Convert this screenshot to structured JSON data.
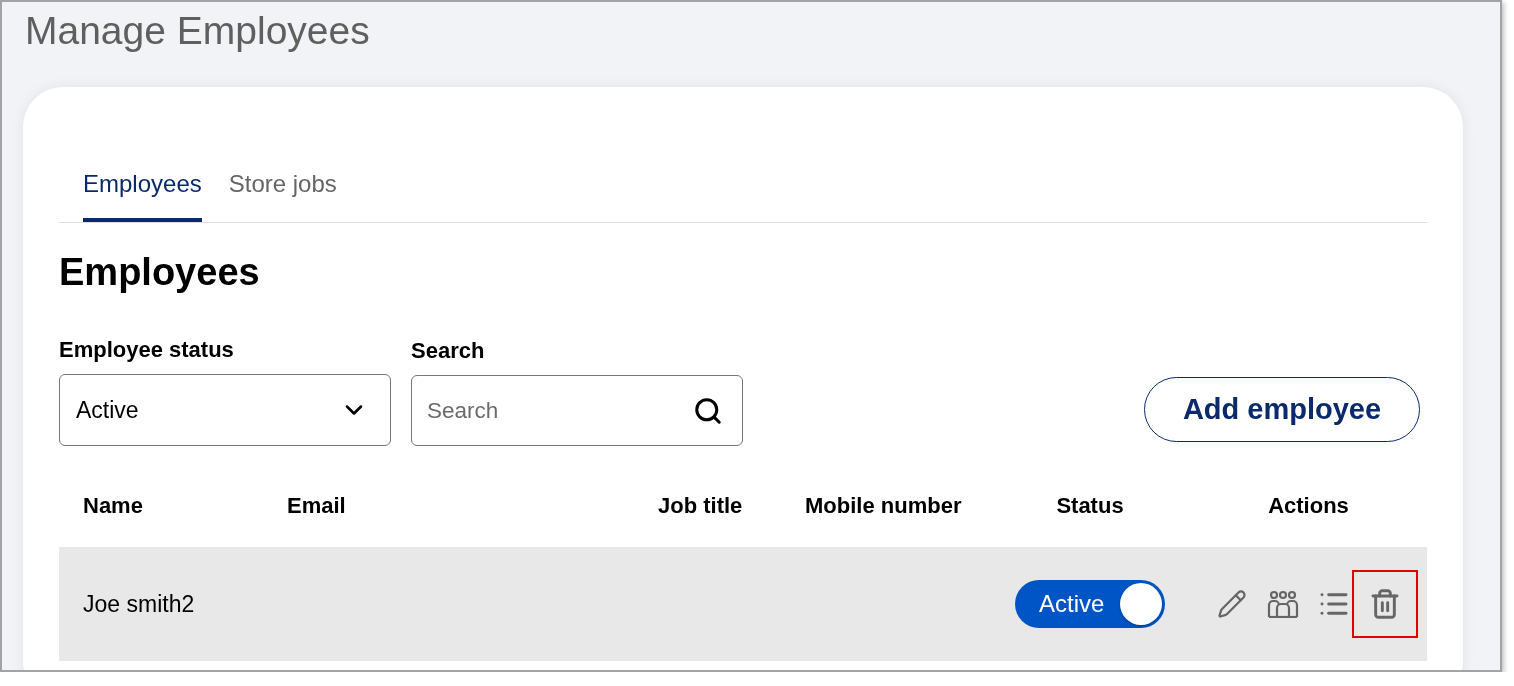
{
  "page": {
    "title": "Manage Employees"
  },
  "tabs": [
    {
      "label": "Employees",
      "selected": true
    },
    {
      "label": "Store jobs",
      "selected": false
    }
  ],
  "section": {
    "heading": "Employees"
  },
  "filters": {
    "status": {
      "label": "Employee status",
      "value": "Active"
    },
    "search": {
      "label": "Search",
      "placeholder": "Search"
    }
  },
  "add_button": {
    "label": "Add employee"
  },
  "table": {
    "columns": [
      "Name",
      "Email",
      "Job title",
      "Mobile number",
      "Status",
      "Actions"
    ],
    "rows": [
      {
        "highlighted": true,
        "name": "Joe smith2",
        "status": {
          "label": "Active",
          "on": true
        },
        "actions": [
          {
            "kind": "edit",
            "highlighted": false
          },
          {
            "kind": "team",
            "highlighted": false
          },
          {
            "kind": "list",
            "highlighted": false
          },
          {
            "kind": "delete",
            "highlighted": true
          }
        ]
      }
    ]
  }
}
